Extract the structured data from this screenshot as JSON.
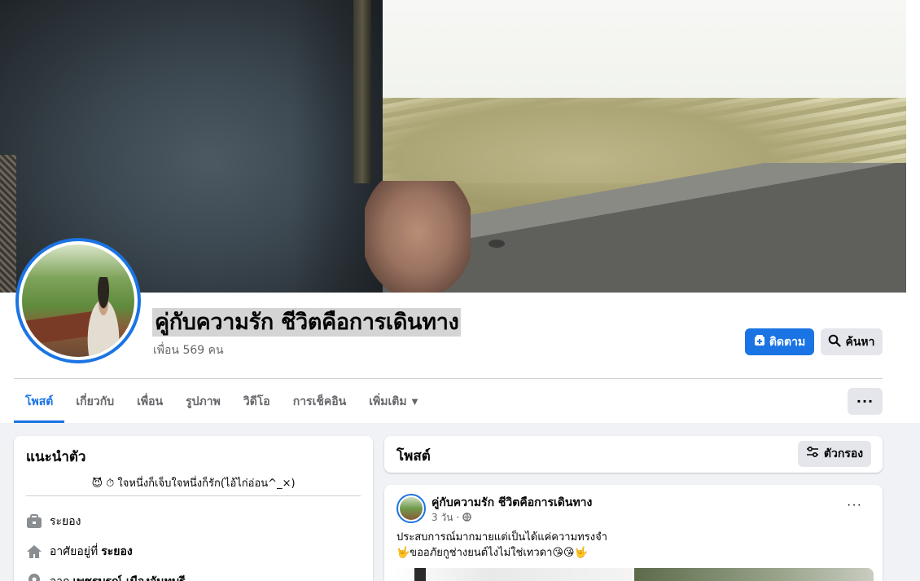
{
  "profile": {
    "name": "คู่กับความรัก ชีวิตคือการเดินทาง",
    "friends": "เพื่อน 569 คน"
  },
  "actions": {
    "follow": "ติดตาม",
    "search": "ค้นหา",
    "more": "···"
  },
  "tabs": [
    {
      "label": "โพสต์",
      "active": true
    },
    {
      "label": "เกี่ยวกับ"
    },
    {
      "label": "เพื่อน"
    },
    {
      "label": "รูปภาพ"
    },
    {
      "label": "วิดีโอ"
    },
    {
      "label": "การเช็คอิน"
    },
    {
      "label": "เพิ่มเติม"
    }
  ],
  "intro": {
    "title": "แนะนำตัว",
    "bio": "😈 ⏱ ใจหนึ่งก็เจ็บใจหนึ่งก็รัก(ไอ้ไก่อ่อน^_×)",
    "rows": [
      {
        "icon": "briefcase-icon",
        "text": "ระยอง",
        "bold": ""
      },
      {
        "icon": "home-icon",
        "text": "อาศัยอยู่ที่",
        "bold": "ระยอง"
      },
      {
        "icon": "location-pin-icon",
        "text": "จาก",
        "bold": "เพชรบูรณ์ เมืองจันทบุรี"
      }
    ]
  },
  "posts_header": {
    "title": "โพสต์",
    "filter": "ตัวกรอง"
  },
  "post": {
    "author": "คู่กับความรัก ชีวิตคือการเดินทาง",
    "time": "3 วัน ·",
    "line1": "ประสบการณ์มากมายแต่เป็นได้แค่ความทรงจำ",
    "line2": "🤟ขออภัยกูช่างยนต์ไงไม่ใช่เทวดา😘😘🤟",
    "dots": "···"
  },
  "colors": {
    "accent": "#1b74e4",
    "secondary_button": "#e4e6eb",
    "background": "#f0f2f5",
    "muted_text": "#65676b"
  }
}
